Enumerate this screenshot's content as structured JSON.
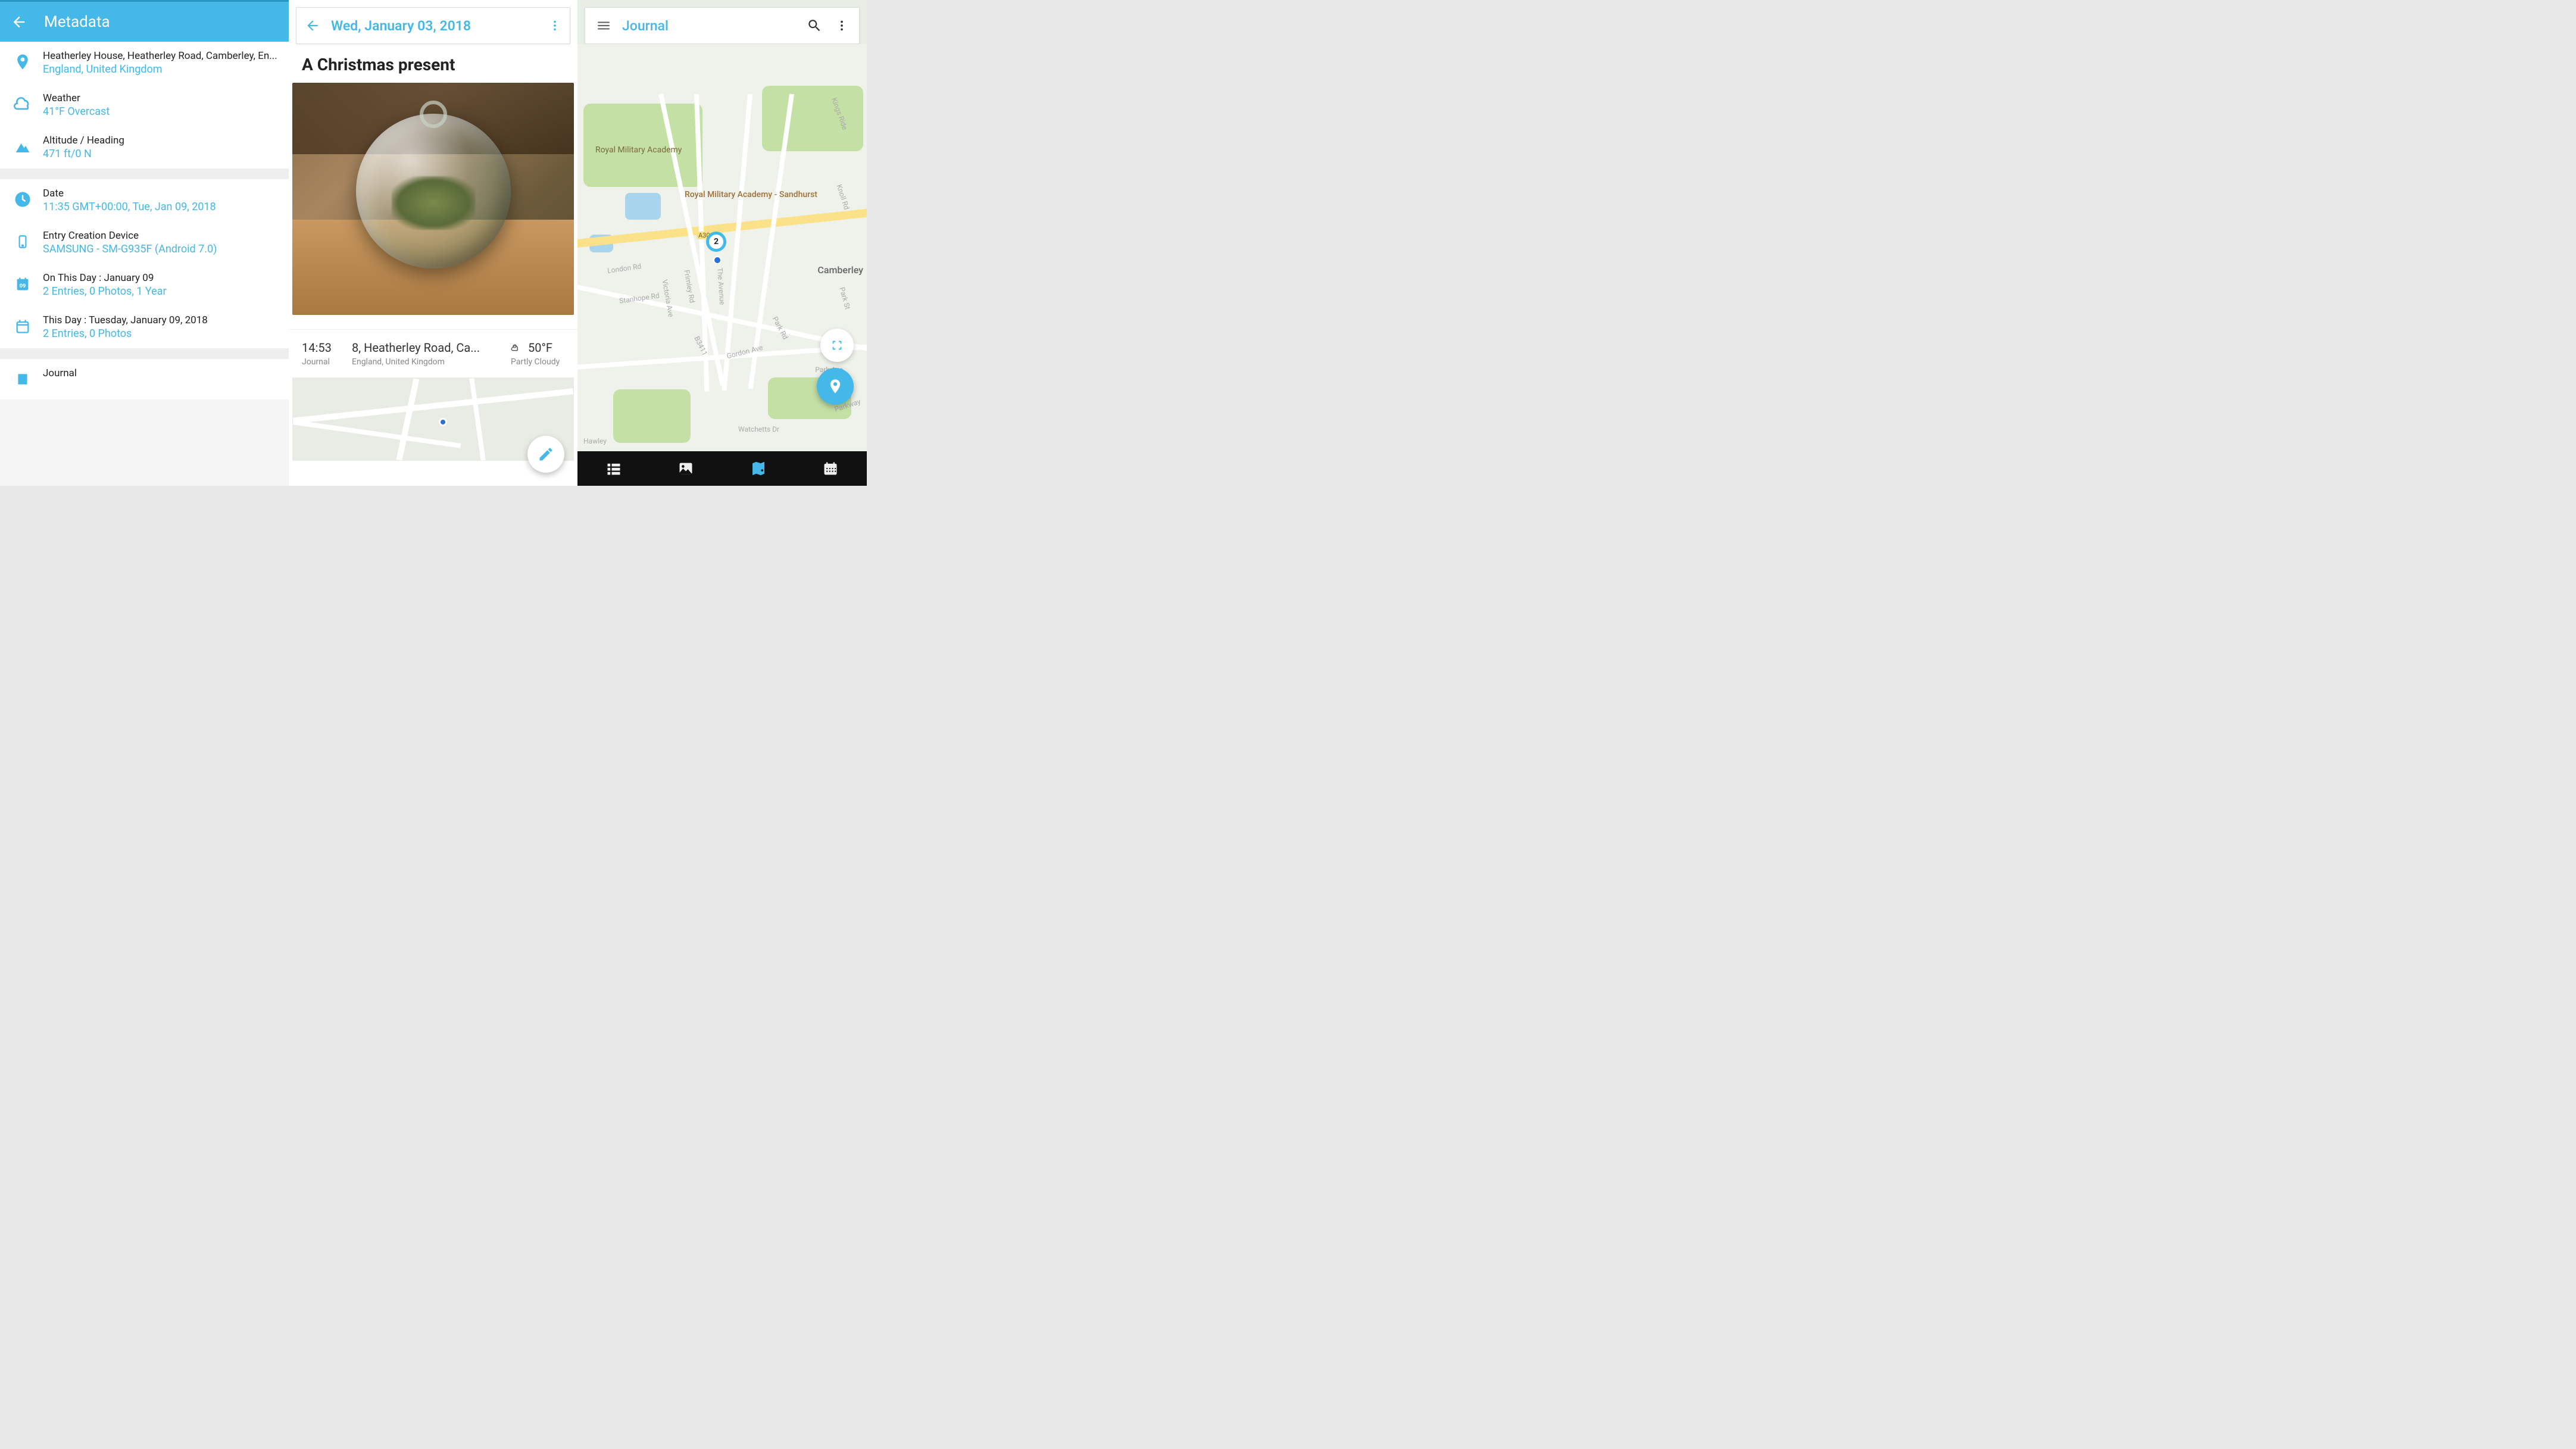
{
  "left": {
    "title": "Metadata",
    "location": {
      "label": "Heatherley House, Heatherley Road, Camberley, En...",
      "value": "England, United Kingdom"
    },
    "weather": {
      "label": "Weather",
      "value": "41°F Overcast"
    },
    "altitude": {
      "label": "Altitude / Heading",
      "value": "471 ft/0 N"
    },
    "date": {
      "label": "Date",
      "value": "11:35 GMT+00:00, Tue, Jan 09, 2018"
    },
    "device": {
      "label": "Entry Creation Device",
      "value": "SAMSUNG - SM-G935F (Android 7.0)"
    },
    "onThisDay": {
      "label": "On This Day : January 09",
      "value": "2 Entries, 0 Photos, 1 Year"
    },
    "thisDay": {
      "label": "This Day : Tuesday, January 09, 2018",
      "value": "2 Entries, 0 Photos"
    },
    "journal": {
      "label": "Journal"
    }
  },
  "mid": {
    "date": "Wed, January 03, 2018",
    "title": "A Christmas present",
    "time": "14:53",
    "journalName": "Journal",
    "address": "8, Heatherley Road, Ca...",
    "region": "England, United Kingdom",
    "temp": "50°F",
    "conditions": "Partly Cloudy"
  },
  "right": {
    "title": "Journal",
    "clusterCount": "2",
    "labels": {
      "rma": "Royal Military Academy",
      "rmaSandhurst": "Royal Military Academy - Sandhurst",
      "camberley": "Camberley",
      "kingsRide": "Kings Ride",
      "knollRd": "Knoll Rd",
      "parkSt": "Park St",
      "parkAve": "Park Ave",
      "parkway": "Parkway",
      "watchettsDr": "Watchetts Dr",
      "gordonAve": "Gordon Ave",
      "parkRd": "Park Rd",
      "b3411": "B3411",
      "theAvenue": "The Avenue",
      "frimleyRd": "Frimley Rd",
      "victoriaAve": "Victoria Ave",
      "stanhopeRd": "Stanhope Rd",
      "londonRd": "London Rd",
      "a30": "A30",
      "hawley": "Hawley"
    }
  }
}
